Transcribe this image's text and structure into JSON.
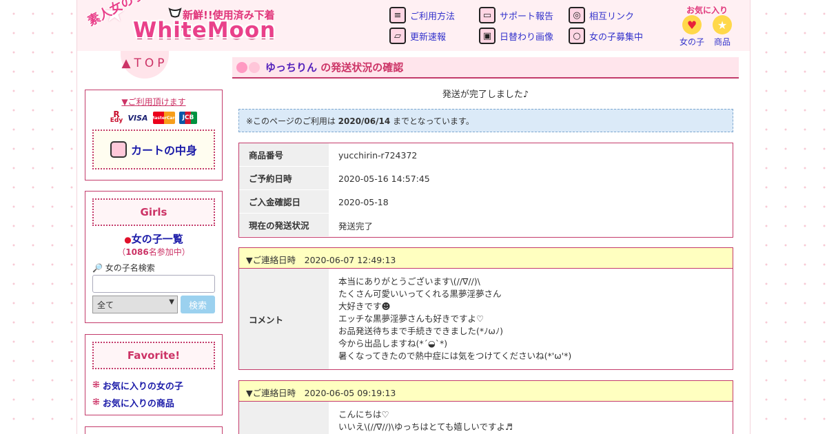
{
  "header": {
    "logo_sub": "新鮮!!使用済み下着",
    "logo_main": "WhiteMoon",
    "logo_jp": "素人女の子の",
    "nav": [
      {
        "label": "ご利用方法",
        "icon": "document-icon"
      },
      {
        "label": "サポート報告",
        "icon": "computer-icon"
      },
      {
        "label": "相互リンク",
        "icon": "globe-icon"
      },
      {
        "label": "更新速報",
        "icon": "folder-icon"
      },
      {
        "label": "日替わり画像",
        "icon": "save-icon"
      },
      {
        "label": "女の子募集中",
        "icon": "ring-icon"
      }
    ],
    "favorites": {
      "title": "お気に入り",
      "girls_label": "女の子",
      "items_label": "商品"
    }
  },
  "sidebar": {
    "top_label": "▲TOP",
    "payment_link": "▼ご利用頂けます",
    "payment_methods": [
      "Edy",
      "VISA",
      "MasterCard",
      "JCB"
    ],
    "cart_label": "カートの中身",
    "girls_heading": "Girls",
    "girls_list_label": "女の子一覧",
    "girls_count_prefix": "（",
    "girls_count": "1086",
    "girls_count_suffix": "名参加中）",
    "search_label": "女の子名検索",
    "search_value": "",
    "search_select": "全て",
    "search_button": "検索",
    "favorite_heading": "Favorite!",
    "favorite_links": [
      "お気に入りの女の子",
      "お気に入りの商品"
    ]
  },
  "main": {
    "title_name": "ゆっちりん",
    "title_rest": " の発送状況の確認",
    "notice": "発送が完了しました♪",
    "info_prefix": "※このページのご利用は ",
    "info_date": "2020/06/14",
    "info_suffix": " までとなっています。",
    "order_rows": [
      {
        "key": "商品番号",
        "value": "yucchirin-r724372"
      },
      {
        "key": "ご予約日時",
        "value": "2020-05-16 14:57:45"
      },
      {
        "key": "ご入金確認日",
        "value": "2020-05-18"
      },
      {
        "key": "現在の発送状況",
        "value": "発送完了"
      }
    ],
    "contacts": [
      {
        "head": "▼ご連絡日時　2020-06-07 12:49:13",
        "key": "コメント",
        "lines": [
          "本当にありがとうございます\\(//∇//)\\",
          "たくさん可愛いいってくれる黒夢淫夢さん",
          "大好きです☻",
          "エッチな黒夢淫夢さんも好きですよ♡",
          "お品発送待ちまで手続きできました(*ﾉωﾉ)",
          "今から出品しますね(*´◒`*)",
          "暑くなってきたので熱中症には気をつけてくださいね(*'ω'*)"
        ]
      },
      {
        "head": "▼ご連絡日時　2020-06-05 09:19:13",
        "key": "",
        "lines": [
          "こんにちは♡",
          "いいえ\\(//∇//)\\ゆっちはとても嬉しいですよ♬"
        ]
      }
    ]
  },
  "colors": {
    "accent": "#cc3366",
    "link": "#1a1aa8",
    "header_bg": "#fff0f3",
    "contact_head_bg": "#ffffc0",
    "info_bg": "#dbeaf8"
  }
}
